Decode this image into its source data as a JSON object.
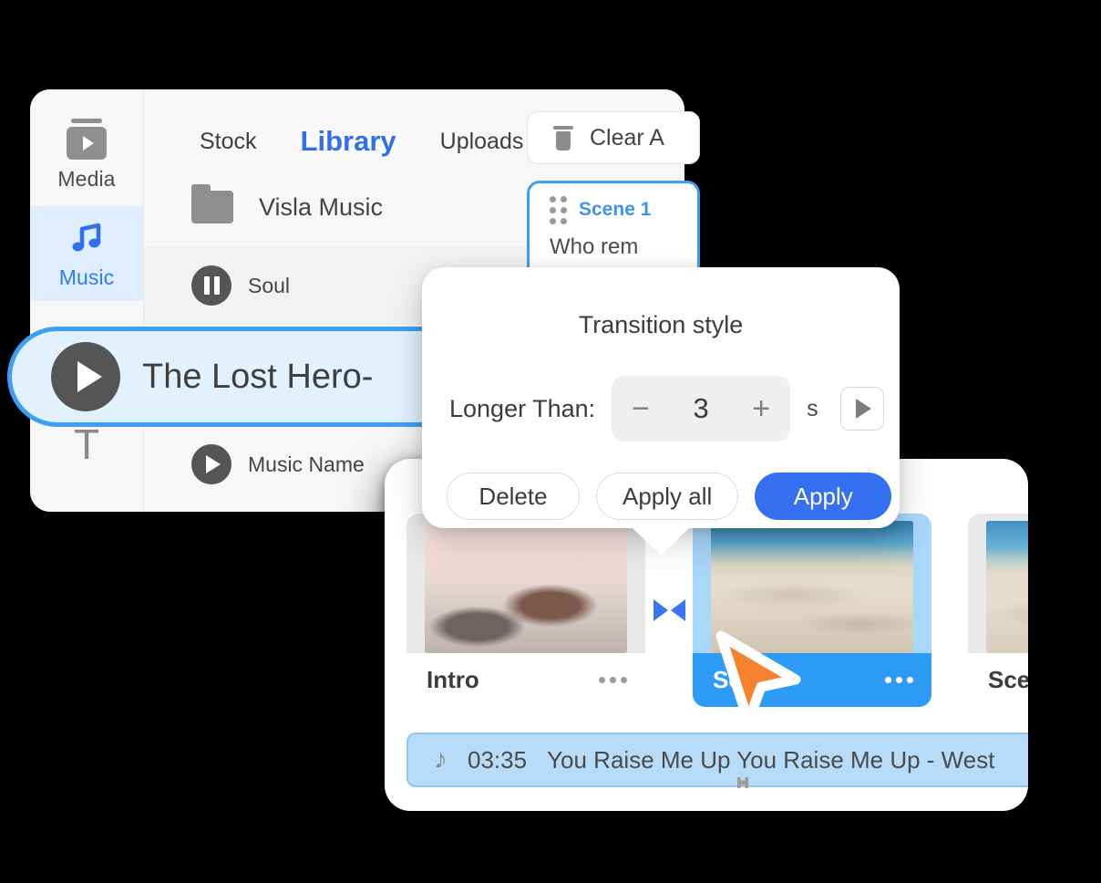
{
  "app": {
    "accent_blue": "#2f6ff0",
    "selection_blue": "#3ba0f5",
    "scene_blue": "#2e9cf6",
    "cursor_orange": "#f5822e"
  },
  "rail": {
    "items": [
      {
        "label": "Media",
        "icon": "media-icon",
        "active": false
      },
      {
        "label": "Music",
        "icon": "music-note-icon",
        "active": true
      },
      {
        "label": "T",
        "icon": "text-icon",
        "active": false
      }
    ]
  },
  "library": {
    "tabs": [
      {
        "label": "Stock",
        "active": false
      },
      {
        "label": "Library",
        "active": true
      },
      {
        "label": "Uploads",
        "active": false
      }
    ],
    "folder": {
      "label": "Visla Music",
      "icon": "folder-icon"
    },
    "tracks": [
      {
        "name": "Soul",
        "state": "paused",
        "icon": "pause-icon"
      },
      {
        "name": "Music Name",
        "state": "stopped",
        "icon": "play-icon"
      }
    ],
    "selected_track": {
      "name": "The Lost Hero-",
      "icon": "play-icon"
    }
  },
  "script_panel": {
    "clear_all_label": "Clear A",
    "clear_all_icon": "trash-icon",
    "scene": {
      "title": "Scene 1",
      "text": "Who rem",
      "grip_icon": "drag-grip-icon"
    }
  },
  "popover": {
    "title": "Transition style",
    "duration_label": "Longer Than:",
    "duration_value": "3",
    "minus_label": "−",
    "plus_label": "+",
    "unit": "s",
    "preview_icon": "play-icon",
    "buttons": {
      "delete": "Delete",
      "apply_all": "Apply all",
      "apply": "Apply"
    }
  },
  "timeline": {
    "scenes": [
      {
        "name": "Intro",
        "thumb": "thumb-van",
        "selected": false,
        "more_icon": "more-dots-icon"
      },
      {
        "name": "Scen",
        "thumb": "thumb-dune",
        "selected": true,
        "more_icon": "more-dots-icon"
      },
      {
        "name": "Scen",
        "thumb": "thumb-dune2",
        "selected": false,
        "more_icon": "more-dots-icon"
      }
    ],
    "transition_icon": "transition-arrows-icon",
    "audio": {
      "note_icon": "music-note-icon",
      "note_glyph": "♪",
      "duration": "03:35",
      "title": "You Raise Me Up You Raise Me Up - West",
      "handle_icon": "audio-handle-icon"
    }
  },
  "cursor": {
    "icon": "pointer-cursor-icon"
  }
}
